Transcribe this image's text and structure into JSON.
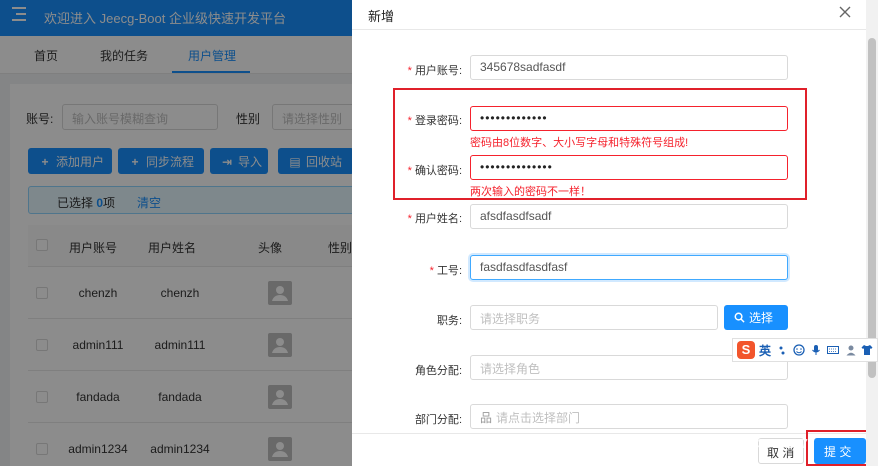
{
  "header": {
    "title": "欢迎进入 Jeecg-Boot 企业级快速开发平台"
  },
  "tabs": [
    {
      "label": "首页"
    },
    {
      "label": "我的任务"
    },
    {
      "label": "用户管理"
    }
  ],
  "search": {
    "account_label": "账号:",
    "account_placeholder": "输入账号模糊查询",
    "gender_label": "性别",
    "gender_placeholder": "请选择性别"
  },
  "toolbar": {
    "add": "添加用户",
    "sync": "同步流程",
    "import": "导入",
    "recycle": "回收站"
  },
  "selection": {
    "prefix": "已选择",
    "count": "0",
    "suffix": "项",
    "clear": "清空"
  },
  "table": {
    "columns": [
      "用户账号",
      "用户姓名",
      "头像",
      "性别"
    ],
    "rows": [
      {
        "account": "chenzh",
        "name": "chenzh"
      },
      {
        "account": "admin111",
        "name": "admin111"
      },
      {
        "account": "fandada",
        "name": "fandada"
      },
      {
        "account": "admin1234",
        "name": "admin1234"
      }
    ]
  },
  "modal": {
    "title": "新增",
    "fields": {
      "username": {
        "label": "用户账号",
        "value": "345678sadfasdf"
      },
      "password": {
        "label": "登录密码",
        "value": "•••••••••••••",
        "error": "密码由8位数字、大小写字母和特殊符号组成!"
      },
      "confirm": {
        "label": "确认密码",
        "value": "••••••••••••••",
        "error": "两次输入的密码不一样！"
      },
      "realname": {
        "label": "用户姓名",
        "value": "afsdfasdfsadf"
      },
      "work_no": {
        "label": "工号",
        "value": "fasdfasdfasdfasf"
      },
      "post": {
        "label": "职务",
        "placeholder": "请选择职务",
        "button": "选择"
      },
      "roles": {
        "label": "角色分配",
        "placeholder": "请选择角色"
      },
      "depart": {
        "label": "部门分配",
        "placeholder": "请点击选择部门"
      }
    },
    "footer": {
      "cancel": "取 消",
      "submit": "提 交"
    }
  },
  "ime": {
    "mode": "英"
  },
  "watermark": "https://blog.csdn.net/weixin_38882877",
  "colors": {
    "primary": "#1890ff",
    "error": "#f5222d",
    "annotation": "#e0202a"
  }
}
